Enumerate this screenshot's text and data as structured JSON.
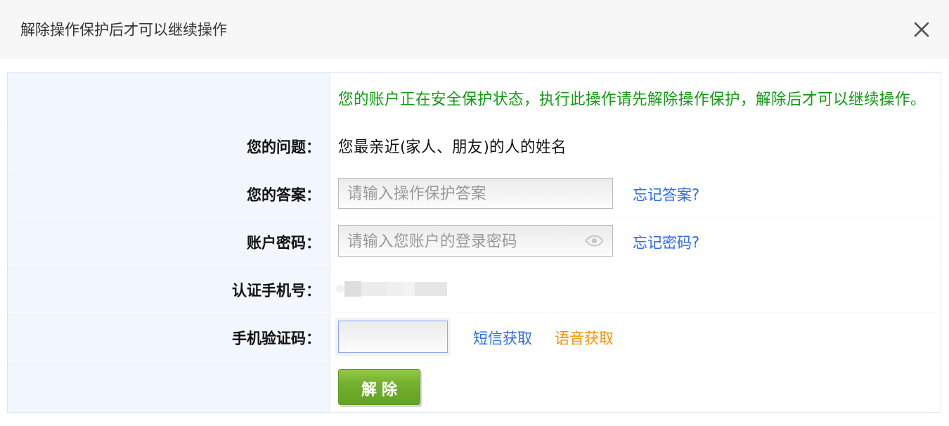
{
  "dialog": {
    "title": "解除操作保护后才可以继续操作"
  },
  "notice": "您的账户正在安全保护状态，执行此操作请先解除操作保护，解除后才可以继续操作。",
  "fields": [
    {
      "kind": "text",
      "label": "您的问题：",
      "value": "您最亲近(家人、朋友)的人的姓名"
    },
    {
      "kind": "input",
      "label": "您的答案：",
      "placeholder": "请输入操作保护答案",
      "links": [
        {
          "text": "忘记答案?",
          "color": "#2f6cf0"
        }
      ]
    },
    {
      "kind": "password",
      "label": "账户密码：",
      "placeholder": "请输入您账户的登录密码",
      "links": [
        {
          "text": "忘记密码?",
          "color": "#2f6cf0"
        }
      ]
    },
    {
      "kind": "redacted",
      "label": "认证手机号：",
      "redacted": true
    },
    {
      "kind": "code",
      "label": "手机验证码：",
      "focused": true,
      "links": [
        {
          "text": "短信获取",
          "color": "#2f6cf0"
        },
        {
          "text": "语音获取",
          "color": "#f7930f"
        }
      ]
    }
  ],
  "submit": {
    "label": "解 除"
  }
}
